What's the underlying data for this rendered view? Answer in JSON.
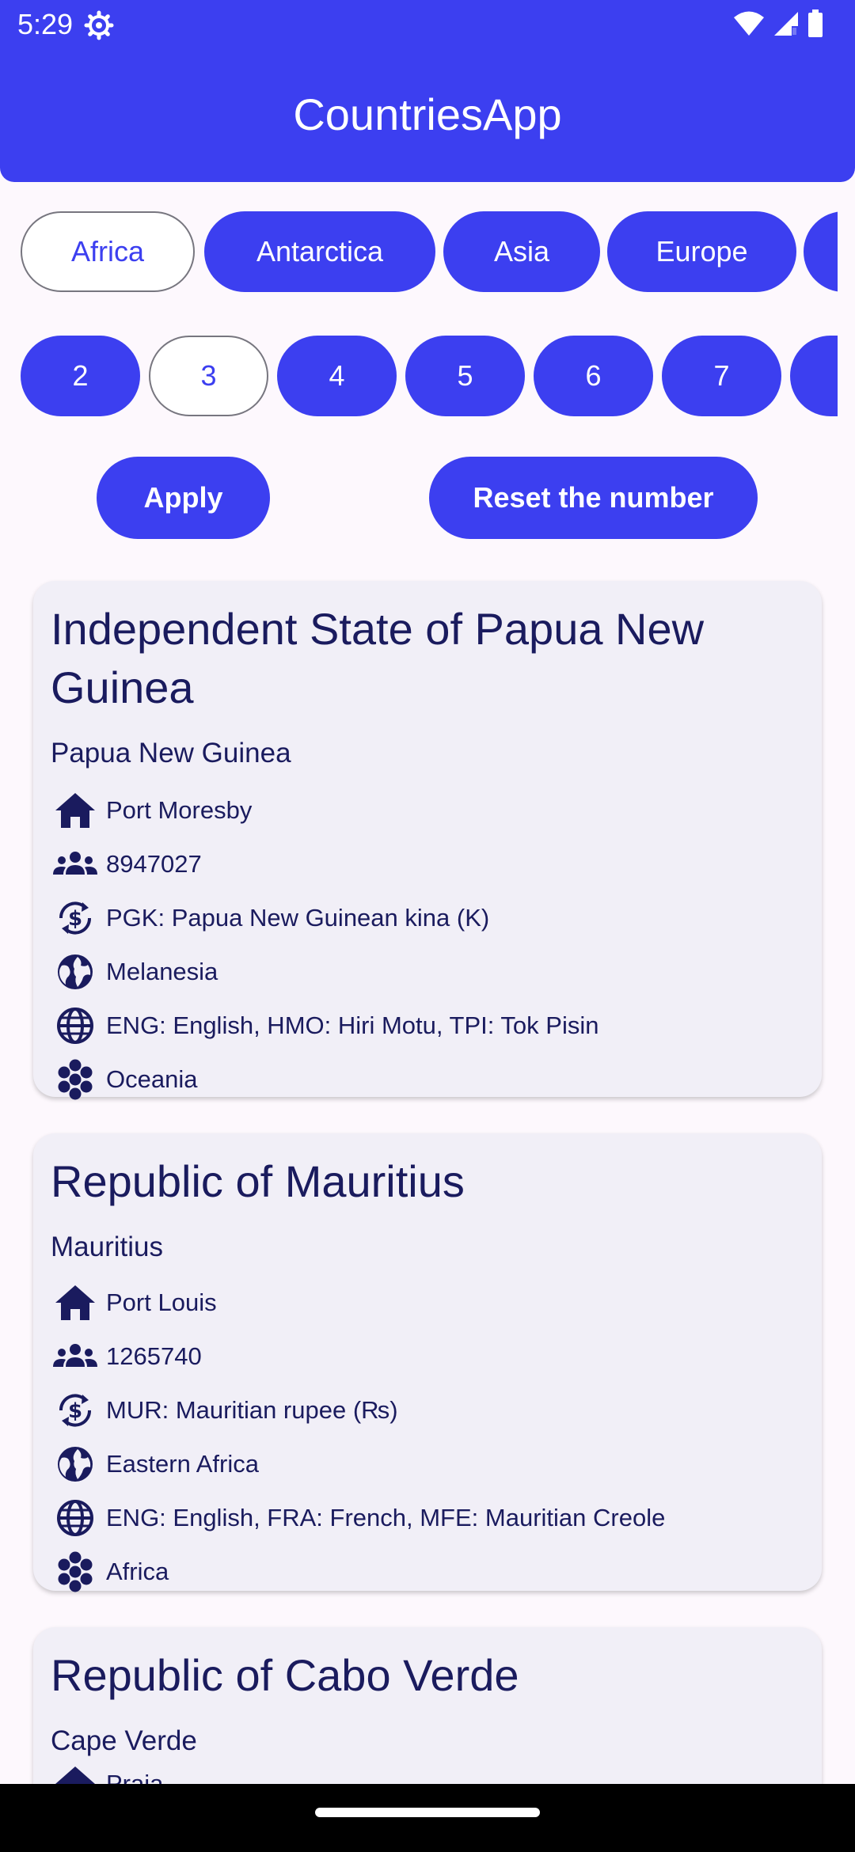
{
  "status_bar": {
    "time": "5:29"
  },
  "app": {
    "title": "CountriesApp"
  },
  "continent_chips": [
    {
      "label": "Africa",
      "selected": true
    },
    {
      "label": "Antarctica",
      "selected": false
    },
    {
      "label": "Asia",
      "selected": false
    },
    {
      "label": "Europe",
      "selected": false
    },
    {
      "label": "",
      "selected": false
    }
  ],
  "number_chips": [
    {
      "label": "2",
      "selected": false
    },
    {
      "label": "3",
      "selected": true
    },
    {
      "label": "4",
      "selected": false
    },
    {
      "label": "5",
      "selected": false
    },
    {
      "label": "6",
      "selected": false
    },
    {
      "label": "7",
      "selected": false
    },
    {
      "label": "",
      "selected": false
    }
  ],
  "actions": {
    "apply_label": "Apply",
    "reset_label": "Reset the number"
  },
  "countries": [
    {
      "official_name": "Independent State of Papua New Guinea",
      "common_name": "Papua New Guinea",
      "capital": "Port Moresby",
      "population": "8947027",
      "currency": "PGK: Papua New Guinean kina (K)",
      "subregion": "Melanesia",
      "languages": "ENG: English, HMO: Hiri Motu, TPI: Tok Pisin",
      "region": "Oceania"
    },
    {
      "official_name": "Republic of Mauritius",
      "common_name": "Mauritius",
      "capital": "Port Louis",
      "population": "1265740",
      "currency": "MUR: Mauritian rupee (₨)",
      "subregion": "Eastern Africa",
      "languages": "ENG: English, FRA: French, MFE: Mauritian Creole",
      "region": "Africa"
    },
    {
      "official_name": "Republic of Cabo Verde",
      "common_name": "Cape Verde",
      "capital": "Praia"
    }
  ],
  "colors": {
    "primary": "#3c3ff0",
    "card_background": "#f1eff7",
    "text_dark": "#1a1b5e",
    "page_background": "#fdf8fd"
  },
  "icons": {
    "capital": "home-icon",
    "population": "groups-icon",
    "currency": "currency-exchange-icon",
    "subregion": "public-globe-icon",
    "languages": "language-icon",
    "region": "hexagon-cluster-icon"
  }
}
